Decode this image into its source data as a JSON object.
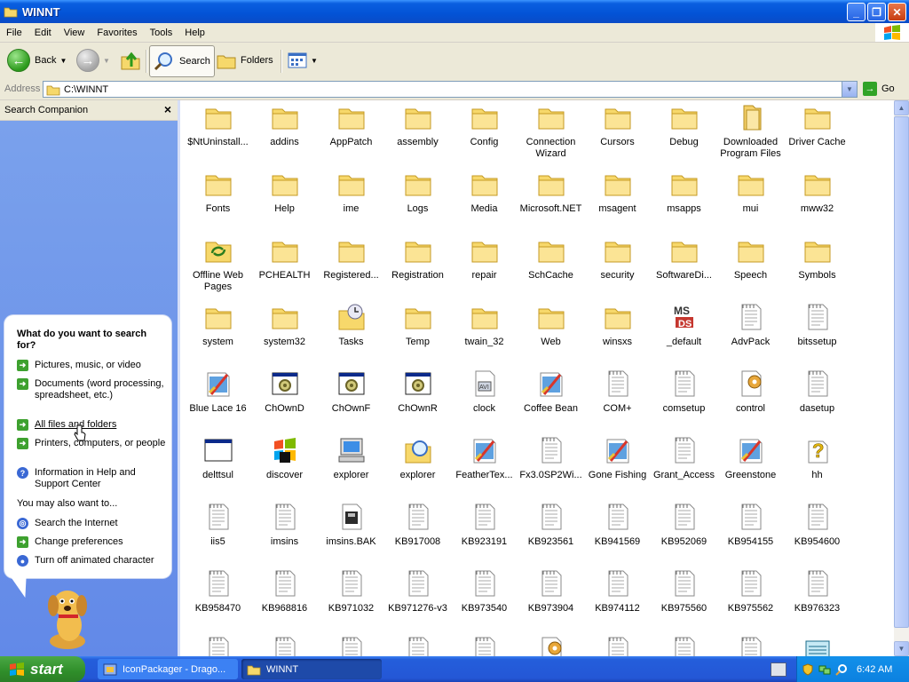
{
  "window": {
    "title": "WINNT"
  },
  "menu": [
    "File",
    "Edit",
    "View",
    "Favorites",
    "Tools",
    "Help"
  ],
  "toolbar": {
    "back": "Back",
    "search": "Search",
    "folders": "Folders"
  },
  "address": {
    "label": "Address",
    "value": "C:\\WINNT",
    "go": "Go"
  },
  "companion": {
    "title": "Search Companion",
    "question": "What do you want to search for?",
    "options": [
      "Pictures, music, or video",
      "Documents (word processing, spreadsheet, etc.)",
      "All files and folders",
      "Printers, computers, or people",
      "Information in Help and Support Center"
    ],
    "also_heading": "You may also want to...",
    "also": [
      "Search the Internet",
      "Change preferences",
      "Turn off animated character"
    ]
  },
  "items": [
    {
      "label": "$NtUninstall...",
      "type": "folder"
    },
    {
      "label": "addins",
      "type": "folder"
    },
    {
      "label": "AppPatch",
      "type": "folder"
    },
    {
      "label": "assembly",
      "type": "folder"
    },
    {
      "label": "Config",
      "type": "folder"
    },
    {
      "label": "Connection Wizard",
      "type": "folder"
    },
    {
      "label": "Cursors",
      "type": "folder"
    },
    {
      "label": "Debug",
      "type": "folder"
    },
    {
      "label": "Downloaded Program Files",
      "type": "folder-special"
    },
    {
      "label": "Driver Cache",
      "type": "folder"
    },
    {
      "label": "Fonts",
      "type": "folder"
    },
    {
      "label": "Help",
      "type": "folder"
    },
    {
      "label": "ime",
      "type": "folder"
    },
    {
      "label": "Logs",
      "type": "folder"
    },
    {
      "label": "Media",
      "type": "folder"
    },
    {
      "label": "Microsoft.NET",
      "type": "folder"
    },
    {
      "label": "msagent",
      "type": "folder"
    },
    {
      "label": "msapps",
      "type": "folder"
    },
    {
      "label": "mui",
      "type": "folder"
    },
    {
      "label": "mww32",
      "type": "folder"
    },
    {
      "label": "Offline Web Pages",
      "type": "offline"
    },
    {
      "label": "PCHEALTH",
      "type": "folder"
    },
    {
      "label": "Registered...",
      "type": "folder"
    },
    {
      "label": "Registration",
      "type": "folder"
    },
    {
      "label": "repair",
      "type": "folder"
    },
    {
      "label": "SchCache",
      "type": "folder"
    },
    {
      "label": "security",
      "type": "folder"
    },
    {
      "label": "SoftwareDi...",
      "type": "folder"
    },
    {
      "label": "Speech",
      "type": "folder"
    },
    {
      "label": "Symbols",
      "type": "folder"
    },
    {
      "label": "system",
      "type": "folder"
    },
    {
      "label": "system32",
      "type": "folder"
    },
    {
      "label": "Tasks",
      "type": "tasks"
    },
    {
      "label": "Temp",
      "type": "folder"
    },
    {
      "label": "twain_32",
      "type": "folder"
    },
    {
      "label": "Web",
      "type": "folder"
    },
    {
      "label": "winsxs",
      "type": "folder"
    },
    {
      "label": "_default",
      "type": "ms"
    },
    {
      "label": "AdvPack",
      "type": "doc"
    },
    {
      "label": "bitssetup",
      "type": "doc"
    },
    {
      "label": "Blue Lace 16",
      "type": "bmp"
    },
    {
      "label": "ChOwnD",
      "type": "exe"
    },
    {
      "label": "ChOwnF",
      "type": "exe"
    },
    {
      "label": "ChOwnR",
      "type": "exe"
    },
    {
      "label": "clock",
      "type": "avi"
    },
    {
      "label": "Coffee Bean",
      "type": "bmp"
    },
    {
      "label": "COM+",
      "type": "doc"
    },
    {
      "label": "comsetup",
      "type": "doc"
    },
    {
      "label": "control",
      "type": "gear"
    },
    {
      "label": "dasetup",
      "type": "doc"
    },
    {
      "label": "delttsul",
      "type": "app"
    },
    {
      "label": "discover",
      "type": "discover"
    },
    {
      "label": "explorer",
      "type": "computer"
    },
    {
      "label": "explorer",
      "type": "search"
    },
    {
      "label": "FeatherTex...",
      "type": "bmp"
    },
    {
      "label": "Fx3.0SP2Wi...",
      "type": "doc"
    },
    {
      "label": "Gone Fishing",
      "type": "bmp"
    },
    {
      "label": "Grant_Access",
      "type": "doc"
    },
    {
      "label": "Greenstone",
      "type": "bmp"
    },
    {
      "label": "hh",
      "type": "help"
    },
    {
      "label": "iis5",
      "type": "doc"
    },
    {
      "label": "imsins",
      "type": "doc"
    },
    {
      "label": "imsins.BAK",
      "type": "bak"
    },
    {
      "label": "KB917008",
      "type": "doc"
    },
    {
      "label": "KB923191",
      "type": "doc"
    },
    {
      "label": "KB923561",
      "type": "doc"
    },
    {
      "label": "KB941569",
      "type": "doc"
    },
    {
      "label": "KB952069",
      "type": "doc"
    },
    {
      "label": "KB954155",
      "type": "doc"
    },
    {
      "label": "KB954600",
      "type": "doc"
    },
    {
      "label": "KB958470",
      "type": "doc"
    },
    {
      "label": "KB968816",
      "type": "doc"
    },
    {
      "label": "KB971032",
      "type": "doc"
    },
    {
      "label": "KB971276-v3",
      "type": "doc"
    },
    {
      "label": "KB973540",
      "type": "doc"
    },
    {
      "label": "KB973904",
      "type": "doc"
    },
    {
      "label": "KB974112",
      "type": "doc"
    },
    {
      "label": "KB975560",
      "type": "doc"
    },
    {
      "label": "KB975562",
      "type": "doc"
    },
    {
      "label": "KB976323",
      "type": "doc"
    },
    {
      "label": "",
      "type": "doc"
    },
    {
      "label": "",
      "type": "doc"
    },
    {
      "label": "",
      "type": "doc"
    },
    {
      "label": "",
      "type": "doc"
    },
    {
      "label": "",
      "type": "doc"
    },
    {
      "label": "",
      "type": "gear"
    },
    {
      "label": "",
      "type": "doc"
    },
    {
      "label": "",
      "type": "doc"
    },
    {
      "label": "",
      "type": "doc"
    },
    {
      "label": "",
      "type": "notepad"
    }
  ],
  "taskbar": {
    "start": "start",
    "tasks": [
      "IconPackager - Drago...",
      "WINNT"
    ],
    "clock": "6:42 AM"
  }
}
